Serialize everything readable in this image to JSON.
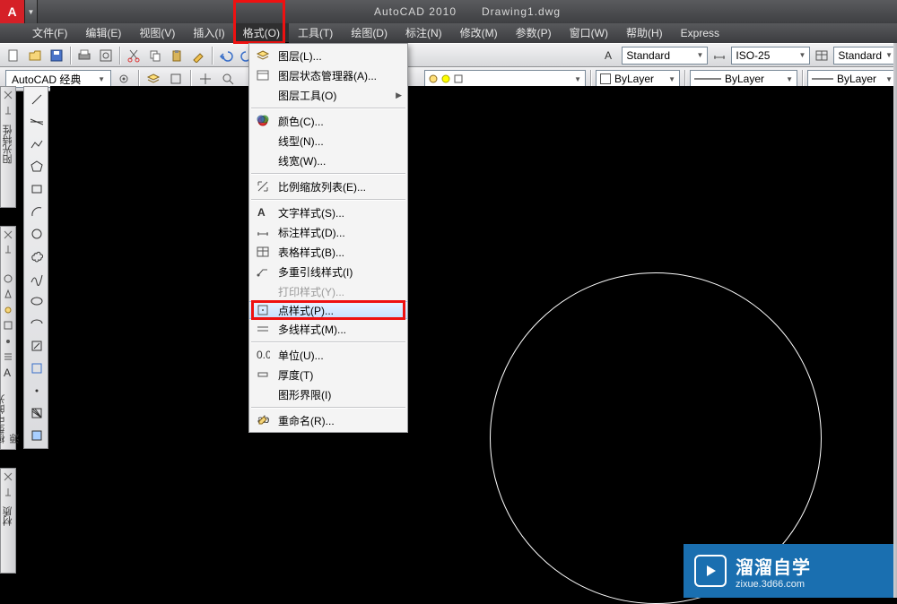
{
  "title": {
    "app": "AutoCAD 2010",
    "doc": "Drawing1.dwg",
    "logo": "A"
  },
  "menu": {
    "items": [
      "文件(F)",
      "编辑(E)",
      "视图(V)",
      "插入(I)",
      "格式(O)",
      "工具(T)",
      "绘图(D)",
      "标注(N)",
      "修改(M)",
      "参数(P)",
      "窗口(W)",
      "帮助(H)",
      "Express"
    ],
    "open_index": 4
  },
  "toolbar": {
    "style_combo": "Standard",
    "dim_combo": "ISO-25",
    "table_combo": "Standard",
    "layer_combo": "ByLayer",
    "color_combo": "ByLayer",
    "ltype_combo": "ByLayer",
    "ws_combo": "AutoCAD 经典"
  },
  "dropdown": [
    {
      "label": "图层(L)...",
      "icon": "layers"
    },
    {
      "label": "图层状态管理器(A)...",
      "icon": "layer-state"
    },
    {
      "label": "图层工具(O)",
      "icon": "",
      "sub": true
    },
    {
      "sep": true
    },
    {
      "label": "颜色(C)...",
      "icon": "color"
    },
    {
      "label": "线型(N)...",
      "icon": ""
    },
    {
      "label": "线宽(W)...",
      "icon": ""
    },
    {
      "sep": true
    },
    {
      "label": "比例缩放列表(E)...",
      "icon": "scale"
    },
    {
      "sep": true
    },
    {
      "label": "文字样式(S)...",
      "icon": "text-style"
    },
    {
      "label": "标注样式(D)...",
      "icon": "dim-style"
    },
    {
      "label": "表格样式(B)...",
      "icon": "table-style"
    },
    {
      "label": "多重引线样式(I)",
      "icon": "mleader"
    },
    {
      "label": "打印样式(Y)...",
      "icon": "",
      "disabled": true
    },
    {
      "label": "点样式(P)...",
      "icon": "point",
      "highlight": true
    },
    {
      "label": "多线样式(M)...",
      "icon": "mline"
    },
    {
      "sep": true
    },
    {
      "label": "单位(U)...",
      "icon": "units"
    },
    {
      "label": "厚度(T)",
      "icon": "thickness"
    },
    {
      "label": "图形界限(I)",
      "icon": ""
    },
    {
      "sep": true
    },
    {
      "label": "重命名(R)...",
      "icon": "rename"
    }
  ],
  "palettes": {
    "p1_title": "阳光特性",
    "p2_title": "模型中的光源",
    "p3_title": "材质"
  },
  "watermark": {
    "big": "溜溜自学",
    "small": "zixue.3d66.com"
  }
}
